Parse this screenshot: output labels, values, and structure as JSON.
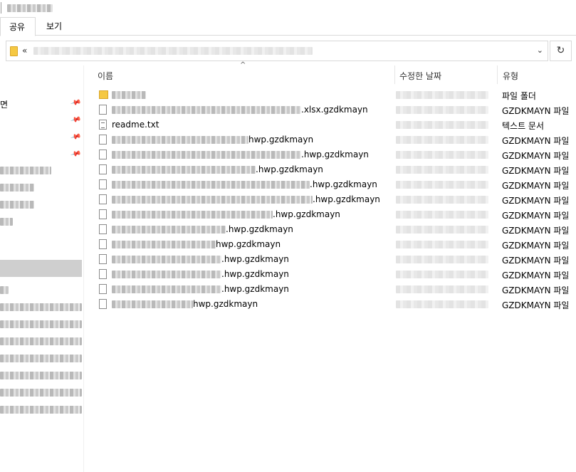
{
  "ribbon": {
    "tabs": [
      "공유",
      "보기"
    ]
  },
  "address": {
    "prefix": "«",
    "dropdown": "⌄",
    "refresh": "↻"
  },
  "columns": {
    "name": "이름",
    "date": "수정한 날짜",
    "type": "유형",
    "sort_indicator": "^"
  },
  "navpane": {
    "partial_label": "면"
  },
  "files": [
    {
      "name_visible": "",
      "type": "파일 폴더",
      "icon": "folder-icon"
    },
    {
      "name_visible": ".xlsx.gzdkmayn",
      "type": "GZDKMAYN 파일",
      "icon": "file-icon"
    },
    {
      "name_visible": "readme.txt",
      "type": "텍스트 문서",
      "icon": "text-file-icon"
    },
    {
      "name_visible": "hwp.gzdkmayn",
      "type": "GZDKMAYN 파일",
      "icon": "file-icon"
    },
    {
      "name_visible": ".hwp.gzdkmayn",
      "type": "GZDKMAYN 파일",
      "icon": "file-icon"
    },
    {
      "name_visible": ".hwp.gzdkmayn",
      "type": "GZDKMAYN 파일",
      "icon": "file-icon"
    },
    {
      "name_visible": ".hwp.gzdkmayn",
      "type": "GZDKMAYN 파일",
      "icon": "file-icon"
    },
    {
      "name_visible": ".hwp.gzdkmayn",
      "type": "GZDKMAYN 파일",
      "icon": "file-icon"
    },
    {
      "name_visible": ".hwp.gzdkmayn",
      "type": "GZDKMAYN 파일",
      "icon": "file-icon"
    },
    {
      "name_visible": ".hwp.gzdkmayn",
      "type": "GZDKMAYN 파일",
      "icon": "file-icon"
    },
    {
      "name_visible": "hwp.gzdkmayn",
      "type": "GZDKMAYN 파일",
      "icon": "file-icon"
    },
    {
      "name_visible": ".hwp.gzdkmayn",
      "type": "GZDKMAYN 파일",
      "icon": "file-icon"
    },
    {
      "name_visible": ".hwp.gzdkmayn",
      "type": "GZDKMAYN 파일",
      "icon": "file-icon"
    },
    {
      "name_visible": ".hwp.gzdkmayn",
      "type": "GZDKMAYN 파일",
      "icon": "file-icon"
    },
    {
      "name_visible": "hwp.gzdkmayn",
      "type": "GZDKMAYN 파일",
      "icon": "file-icon"
    }
  ]
}
